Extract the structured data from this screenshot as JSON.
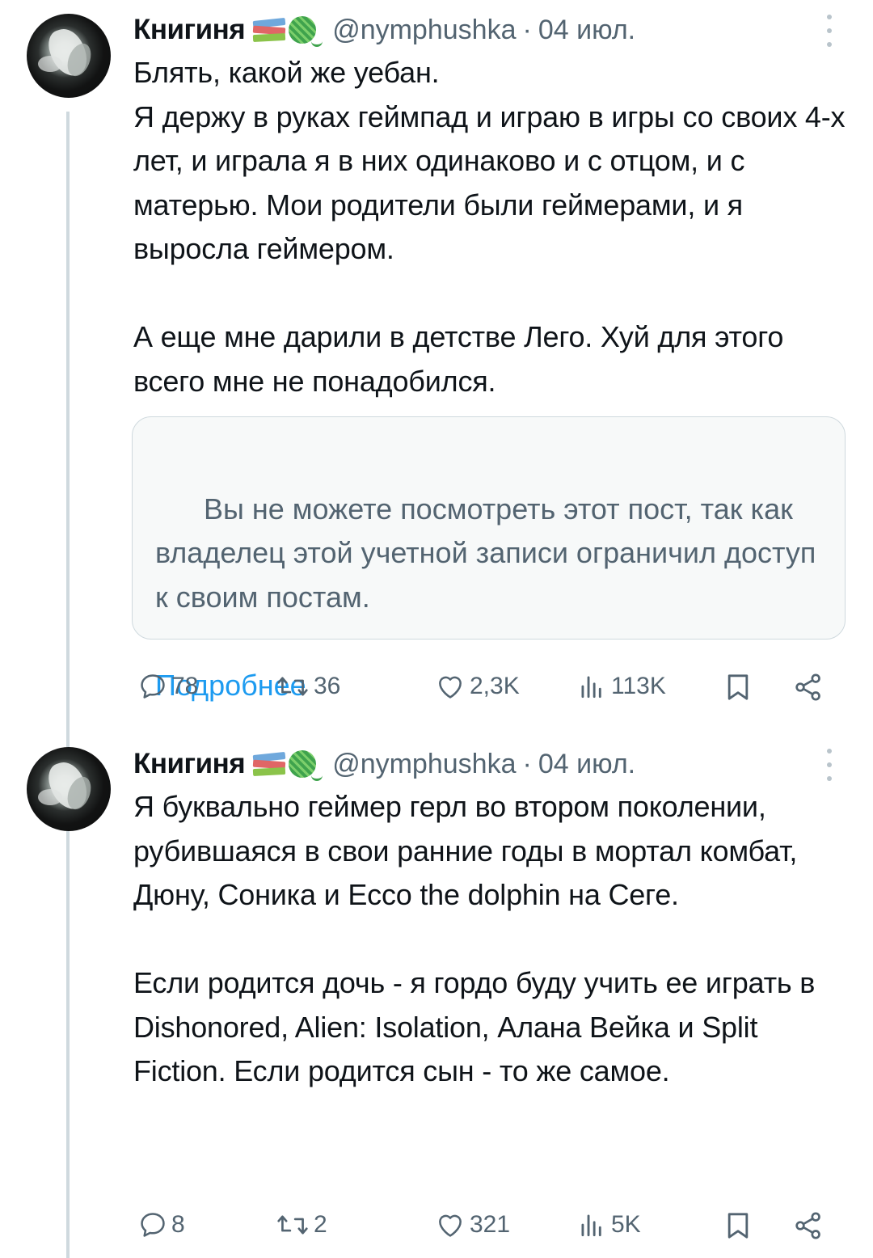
{
  "tweets": [
    {
      "author_name": "Книгиня",
      "author_emoji": [
        "books-emoji",
        "yarn-emoji"
      ],
      "handle": "@nymphushka",
      "separator": "·",
      "date": "04 июл.",
      "text": "Блять, какой же уебан.\nЯ держу в руках геймпад и играю в игры со своих 4-х лет, и играла я в них одинаково и с отцом, и с матерью. Мои родители были геймерами, и я выросла геймером.\n\nА еще мне дарили в детстве Лего. Хуй для этого всего мне не понадобился.",
      "quote": {
        "message": "Вы не можете посмотреть этот пост, так как владелец этой учетной записи ограничил доступ к своим постам.",
        "link": "Подробнее"
      },
      "actions": {
        "replies": "78",
        "retweets": "36",
        "likes": "2,3K",
        "views": "113K"
      }
    },
    {
      "author_name": "Книгиня",
      "author_emoji": [
        "books-emoji",
        "yarn-emoji"
      ],
      "handle": "@nymphushka",
      "separator": "·",
      "date": "04 июл.",
      "text": "Я буквально геймер герл во втором поколении, рубившаяся в свои ранние годы в мортал комбат, Дюну, Соника и Ecco the dolphin на Сеге.\n\nЕсли родится дочь - я гордо буду учить ее играть в Dishonored, Alien: Isolation, Алана Вейка и Split Fiction. Если родится сын - то же самое.",
      "actions": {
        "replies": "8",
        "retweets": "2",
        "likes": "321",
        "views": "5K"
      }
    }
  ],
  "colors": {
    "text": "#0f1419",
    "secondary": "#536471",
    "link": "#1d9bf0",
    "thread_line": "#cfd9de",
    "quote_bg": "#f7f9f9"
  }
}
